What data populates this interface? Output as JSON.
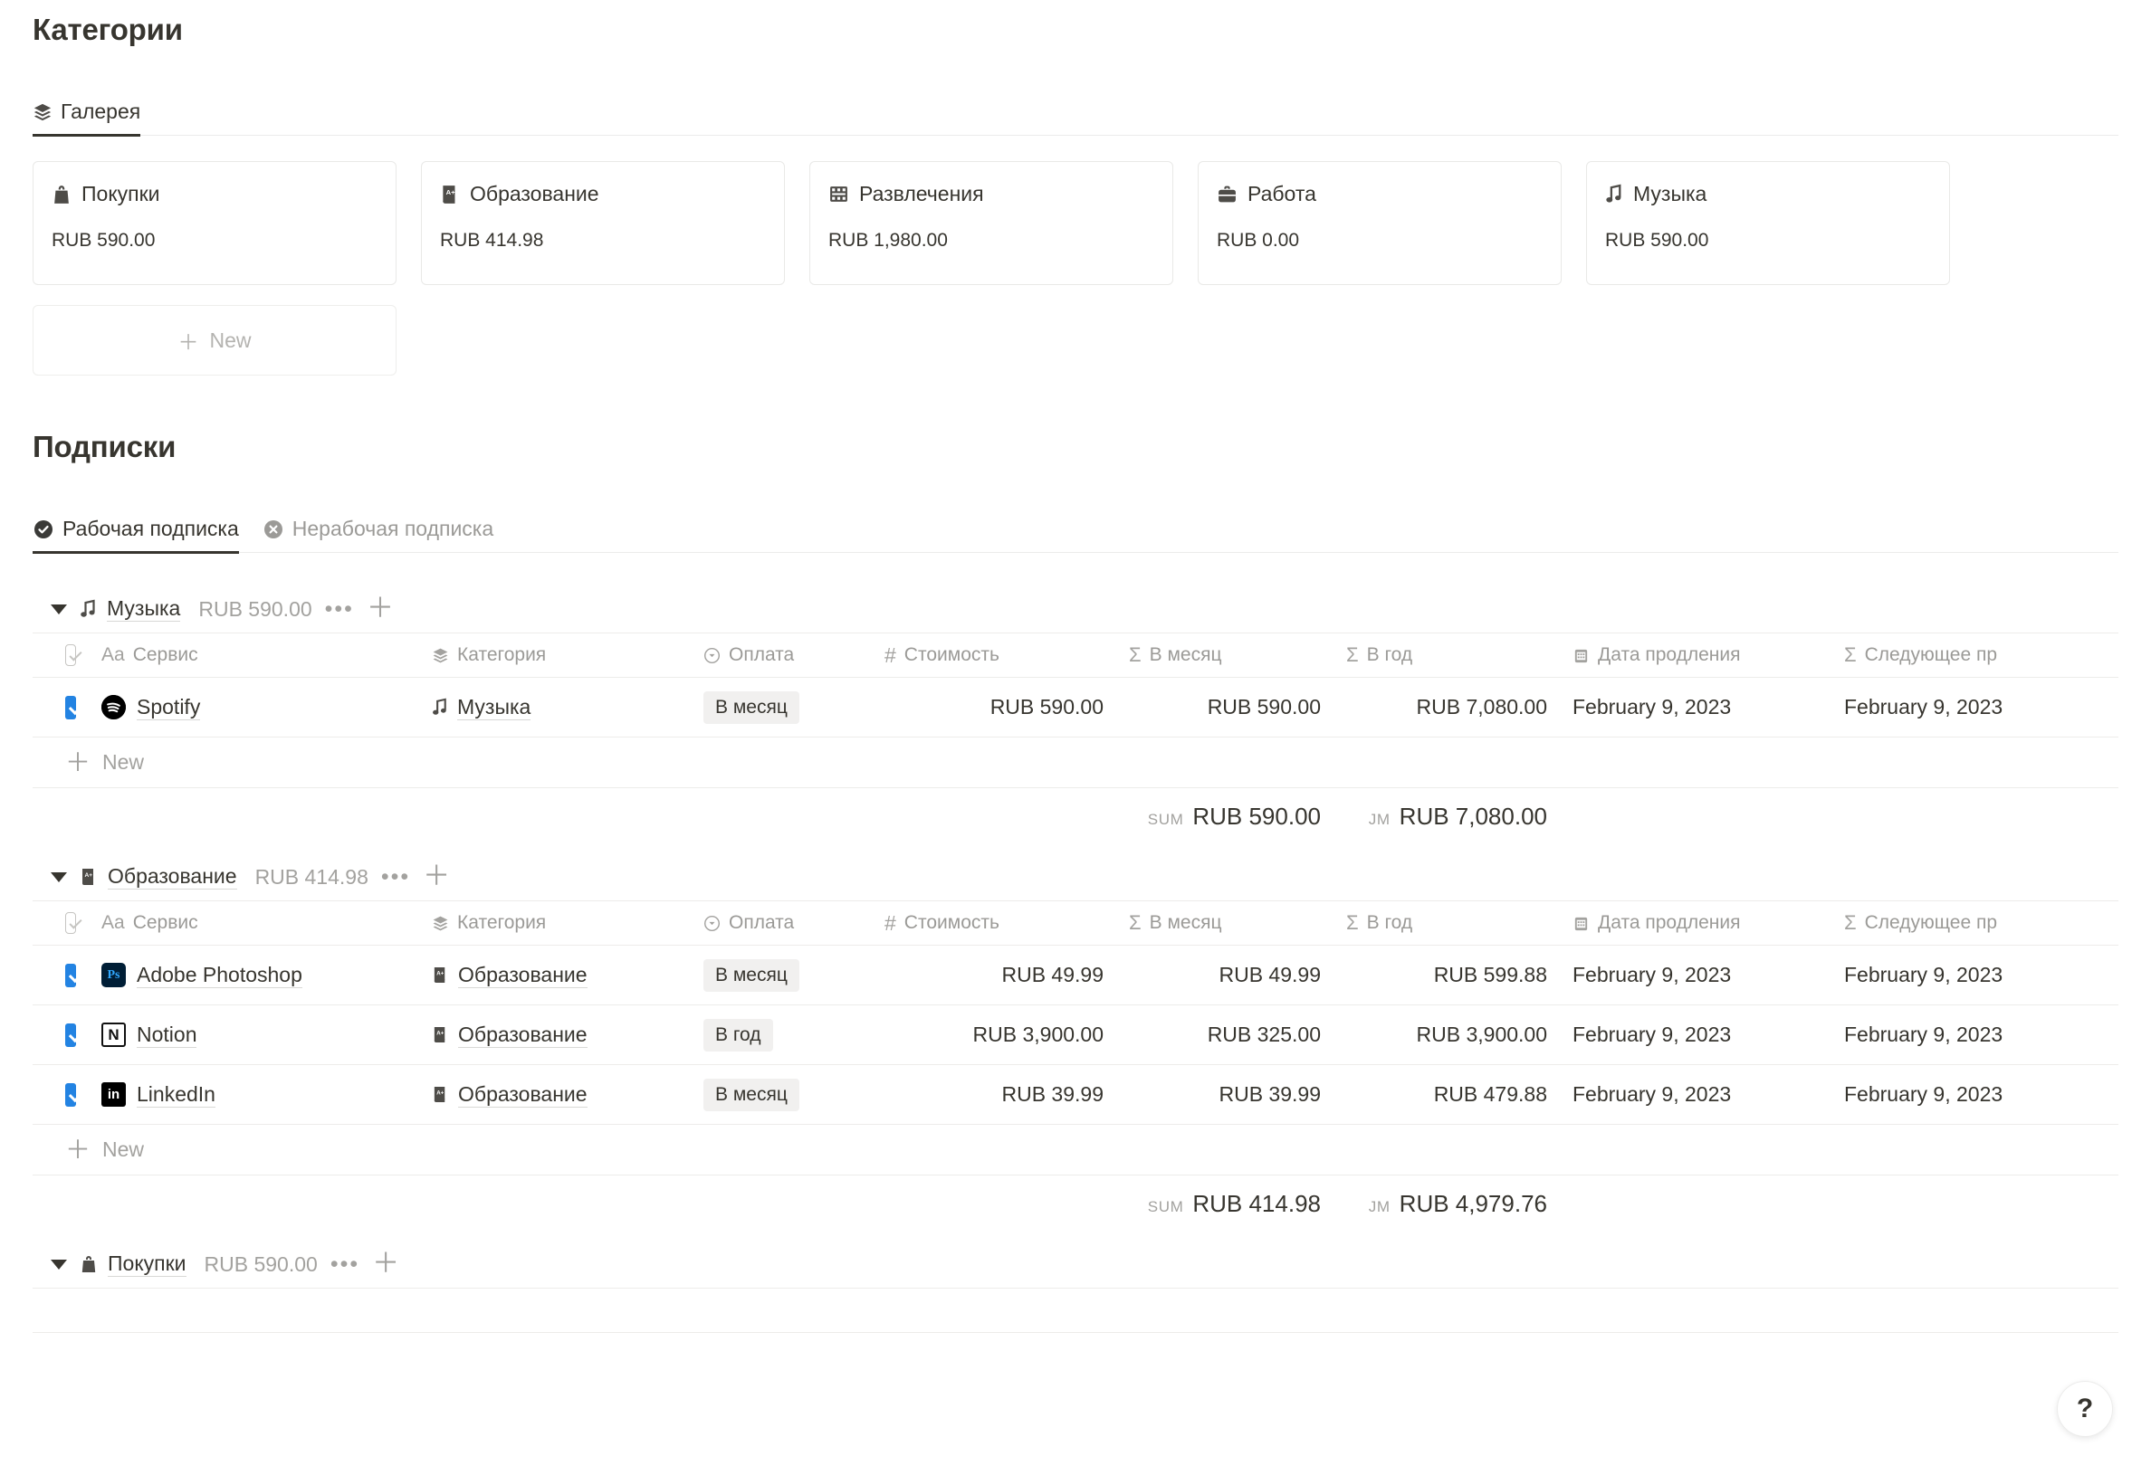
{
  "categories_section": {
    "title": "Категории",
    "view_tab": {
      "label": "Галерея",
      "icon": "layers-icon"
    },
    "cards": [
      {
        "icon": "shopping-bag-icon",
        "name": "Покупки",
        "amount": "RUB 590.00"
      },
      {
        "icon": "education-book-icon",
        "name": "Образование",
        "amount": "RUB 414.98"
      },
      {
        "icon": "film-strip-icon",
        "name": "Развлечения",
        "amount": "RUB 1,980.00"
      },
      {
        "icon": "briefcase-icon",
        "name": "Работа",
        "amount": "RUB 0.00"
      },
      {
        "icon": "music-note-icon",
        "name": "Музыка",
        "amount": "RUB 590.00"
      }
    ],
    "new_card_label": "New"
  },
  "subscriptions_section": {
    "title": "Подписки",
    "tabs": [
      {
        "label": "Рабочая подписка",
        "icon": "check-circle-icon",
        "active": true
      },
      {
        "label": "Нерабочая подписка",
        "icon": "x-circle-icon",
        "active": false
      }
    ],
    "columns": [
      {
        "label": "Сервис",
        "icon": "text-aa-icon"
      },
      {
        "label": "Категория",
        "icon": "layers-icon"
      },
      {
        "label": "Оплата",
        "icon": "select-circle-icon"
      },
      {
        "label": "Стоимость",
        "icon": "hash-icon"
      },
      {
        "label": "В месяц",
        "icon": "sigma-icon"
      },
      {
        "label": "В год",
        "icon": "sigma-icon"
      },
      {
        "label": "Дата продления",
        "icon": "calendar-icon"
      },
      {
        "label": "Следующее пр",
        "icon": "sigma-icon"
      }
    ],
    "new_row_label": "New",
    "sum_label": "SUM",
    "sum_label_2": "JM",
    "groups": [
      {
        "icon": "music-note-icon",
        "name": "Музыка",
        "amount": "RUB 590.00",
        "rows": [
          {
            "checked": true,
            "logo": "spotify-logo",
            "service": "Spotify",
            "category_icon": "music-note-icon",
            "category": "Музыка",
            "payment": "В месяц",
            "cost": "RUB 590.00",
            "per_month": "RUB 590.00",
            "per_year": "RUB 7,080.00",
            "renewal_date": "February 9, 2023",
            "next_payment": "February 9, 2023"
          }
        ],
        "sum_month": "RUB 590.00",
        "sum_year": "RUB 7,080.00"
      },
      {
        "icon": "education-book-icon",
        "name": "Образование",
        "amount": "RUB 414.98",
        "rows": [
          {
            "checked": true,
            "logo": "photoshop-logo",
            "service": "Adobe Photoshop",
            "category_icon": "education-book-icon",
            "category": "Образование",
            "payment": "В месяц",
            "cost": "RUB 49.99",
            "per_month": "RUB 49.99",
            "per_year": "RUB 599.88",
            "renewal_date": "February 9, 2023",
            "next_payment": "February 9, 2023"
          },
          {
            "checked": true,
            "logo": "notion-logo",
            "service": "Notion",
            "category_icon": "education-book-icon",
            "category": "Образование",
            "payment": "В год",
            "cost": "RUB 3,900.00",
            "per_month": "RUB 325.00",
            "per_year": "RUB 3,900.00",
            "renewal_date": "February 9, 2023",
            "next_payment": "February 9, 2023"
          },
          {
            "checked": true,
            "logo": "linkedin-logo",
            "service": "LinkedIn",
            "category_icon": "education-book-icon",
            "category": "Образование",
            "payment": "В месяц",
            "cost": "RUB 39.99",
            "per_month": "RUB 39.99",
            "per_year": "RUB 479.88",
            "renewal_date": "February 9, 2023",
            "next_payment": "February 9, 2023"
          }
        ],
        "sum_month": "RUB 414.98",
        "sum_year": "RUB 4,979.76"
      },
      {
        "icon": "shopping-bag-icon",
        "name": "Покупки",
        "amount": "RUB 590.00",
        "rows": [],
        "sum_month": "",
        "sum_year": ""
      }
    ]
  },
  "help_button": {
    "label": "?"
  },
  "colors": {
    "accent": "#2383e2",
    "text": "#37352f",
    "muted": "#9b9a97",
    "border": "#edecea"
  }
}
